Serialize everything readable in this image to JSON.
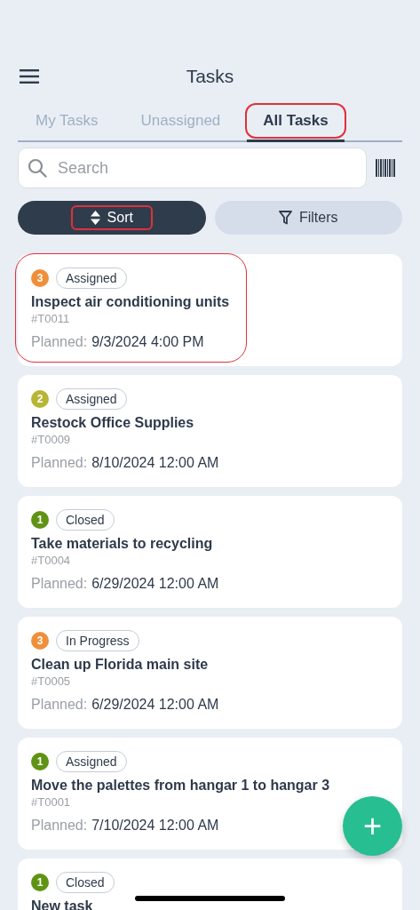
{
  "header": {
    "title": "Tasks"
  },
  "tabs": [
    {
      "label": "My Tasks",
      "selected": false,
      "highlighted": false
    },
    {
      "label": "Unassigned",
      "selected": false,
      "highlighted": false
    },
    {
      "label": "All Tasks",
      "selected": true,
      "highlighted": true
    }
  ],
  "search": {
    "placeholder": "Search"
  },
  "sort_button": {
    "label": "Sort",
    "highlighted": true
  },
  "filters_button": {
    "label": "Filters"
  },
  "tasks": [
    {
      "priority": "3",
      "color": "#ef8f3a",
      "status": "Assigned",
      "title": "Inspect air conditioning units",
      "id": "#T0011",
      "planned_label": "Planned:",
      "planned": "9/3/2024 4:00 PM",
      "highlighted": true
    },
    {
      "priority": "2",
      "color": "#b7b534",
      "status": "Assigned",
      "title": "Restock Office Supplies",
      "id": "#T0009",
      "planned_label": "Planned:",
      "planned": "8/10/2024 12:00 AM",
      "highlighted": false
    },
    {
      "priority": "1",
      "color": "#5f9314",
      "status": "Closed",
      "title": "Take materials to recycling",
      "id": "#T0004",
      "planned_label": "Planned:",
      "planned": "6/29/2024 12:00 AM",
      "highlighted": false
    },
    {
      "priority": "3",
      "color": "#ef8f3a",
      "status": "In Progress",
      "title": "Clean up Florida main site",
      "id": "#T0005",
      "planned_label": "Planned:",
      "planned": "6/29/2024 12:00 AM",
      "highlighted": false
    },
    {
      "priority": "1",
      "color": "#5f9314",
      "status": "Assigned",
      "title": "Move the palettes from hangar 1 to hangar 3",
      "id": "#T0001",
      "planned_label": "Planned:",
      "planned": "7/10/2024 12:00 AM",
      "highlighted": false
    },
    {
      "priority": "1",
      "color": "#5f9314",
      "status": "Closed",
      "title": "New task"
    }
  ],
  "add_button": {
    "label": "+"
  }
}
